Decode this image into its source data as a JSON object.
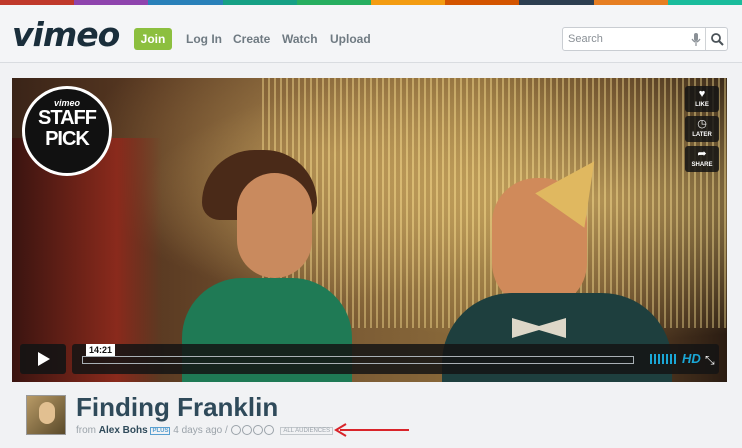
{
  "header": {
    "logo": "vimeo",
    "nav": {
      "join": "Join",
      "login": "Log In",
      "create": "Create",
      "watch": "Watch",
      "upload": "Upload"
    },
    "search": {
      "placeholder": "Search",
      "value": ""
    },
    "stripe_colors": [
      "#c0392b",
      "#8e44ad",
      "#2980b9",
      "#16a085",
      "#27ae60",
      "#f39c12",
      "#d35400",
      "#2c3e50",
      "#e67e22",
      "#1abc9c"
    ]
  },
  "player": {
    "badge": {
      "brand": "vimeo",
      "line1": "STAFF",
      "line2": "PICK"
    },
    "side_buttons": [
      {
        "icon": "heart-icon",
        "glyph": "♥",
        "label": "LIKE"
      },
      {
        "icon": "clock-icon",
        "glyph": "◷",
        "label": "LATER"
      },
      {
        "icon": "share-icon",
        "glyph": "➦",
        "label": "SHARE"
      }
    ],
    "timecode": "14:21",
    "hd_label": "HD",
    "accent": "#1aa7d6"
  },
  "video": {
    "title": "Finding Franklin",
    "by_prefix": "from",
    "author": "Alex Bohs",
    "author_badge": "PLUS",
    "age": "4 days ago",
    "separator": "/",
    "audience": "ALL AUDIENCES"
  },
  "annotation": {
    "arrow_color": "#d9242a"
  }
}
